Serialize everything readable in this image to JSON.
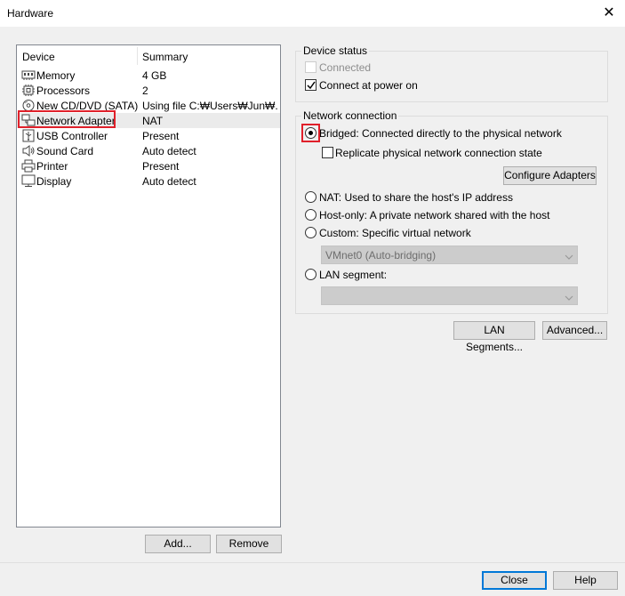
{
  "window": {
    "title": "Hardware",
    "close_glyph": "✕"
  },
  "device_list": {
    "headers": {
      "device": "Device",
      "summary": "Summary"
    },
    "rows": [
      {
        "name": "Memory",
        "summary": "4 GB",
        "icon": "memory-icon"
      },
      {
        "name": "Processors",
        "summary": "2",
        "icon": "processor-icon"
      },
      {
        "name": "New CD/DVD (SATA)",
        "summary": "Using file C:₩Users₩Jun₩...",
        "icon": "cd-dvd-icon"
      },
      {
        "name": "Network Adapter",
        "summary": "NAT",
        "icon": "network-adapter-icon",
        "selected": true
      },
      {
        "name": "USB Controller",
        "summary": "Present",
        "icon": "usb-icon"
      },
      {
        "name": "Sound Card",
        "summary": "Auto detect",
        "icon": "speaker-icon"
      },
      {
        "name": "Printer",
        "summary": "Present",
        "icon": "printer-icon"
      },
      {
        "name": "Display",
        "summary": "Auto detect",
        "icon": "monitor-icon"
      }
    ],
    "add_label": "Add...",
    "remove_label": "Remove"
  },
  "device_status": {
    "legend": "Device status",
    "connected": {
      "label": "Connected",
      "checked": false,
      "enabled": false
    },
    "connect_at_power_on": {
      "label": "Connect at power on",
      "checked": true
    }
  },
  "network_connection": {
    "legend": "Network connection",
    "bridged": {
      "label": "Bridged: Connected directly to the physical network",
      "selected": true
    },
    "replicate": {
      "label": "Replicate physical network connection state",
      "checked": false
    },
    "configure_adapters_label": "Configure Adapters",
    "nat": {
      "label": "NAT: Used to share the host's IP address",
      "selected": false
    },
    "host_only": {
      "label": "Host-only: A private network shared with the host",
      "selected": false
    },
    "custom": {
      "label": "Custom: Specific virtual network",
      "selected": false
    },
    "custom_select": {
      "value": "VMnet0 (Auto-bridging)",
      "enabled": false
    },
    "lan_segment": {
      "label": "LAN segment:",
      "selected": false
    },
    "lan_segment_select": {
      "value": "",
      "enabled": false
    }
  },
  "actions": {
    "lan_segments_label": "LAN Segments...",
    "advanced_label": "Advanced..."
  },
  "footer": {
    "close_label": "Close",
    "help_label": "Help"
  },
  "colors": {
    "highlight": "#e0202a",
    "selected_row": "#ebebeb",
    "accent": "#0078d7"
  }
}
